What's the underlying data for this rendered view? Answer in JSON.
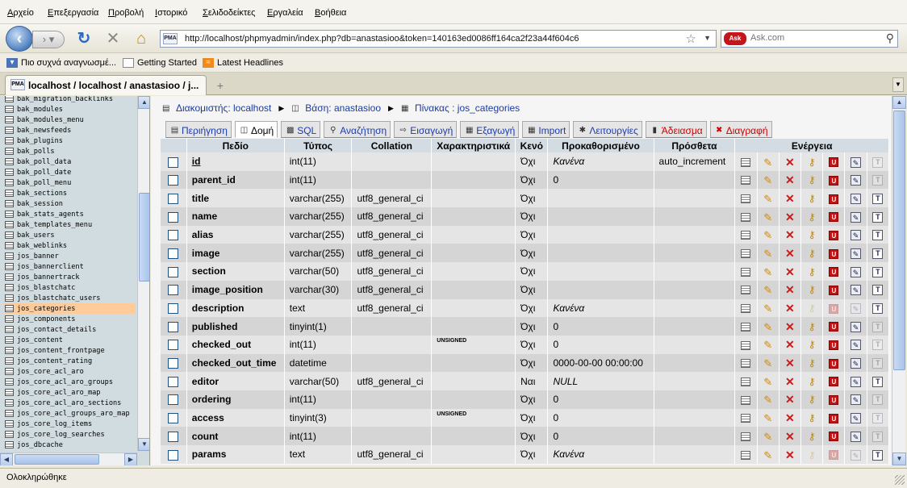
{
  "browser": {
    "menus": [
      "Αρχείο",
      "Επεξεργασία",
      "Προβολή",
      "Ιστορικό",
      "Σελιδοδείκτες",
      "Εργαλεία",
      "Βοήθεια"
    ],
    "url": "http://localhost/phpmyadmin/index.php?db=anastasioo&token=140163ed0086ff164ca2f23a44f604c6",
    "url_badge": "PMA",
    "search_engine": "Ask",
    "search_placeholder": "Ask.com",
    "bookmarks": [
      "Πιο συχνά αναγνωσμέ...",
      "Getting Started",
      "Latest Headlines"
    ],
    "tab_title": "localhost / localhost / anastasioo / j...",
    "status": "Ολοκληρώθηκε"
  },
  "sidebar": {
    "tables": [
      "bak_migration_backlinks",
      "bak_modules",
      "bak_modules_menu",
      "bak_newsfeeds",
      "bak_plugins",
      "bak_polls",
      "bak_poll_data",
      "bak_poll_date",
      "bak_poll_menu",
      "bak_sections",
      "bak_session",
      "bak_stats_agents",
      "bak_templates_menu",
      "bak_users",
      "bak_weblinks",
      "jos_banner",
      "jos_bannerclient",
      "jos_bannertrack",
      "jos_blastchatc",
      "jos_blastchatc_users",
      "jos_categories",
      "jos_components",
      "jos_contact_details",
      "jos_content",
      "jos_content_frontpage",
      "jos_content_rating",
      "jos_core_acl_aro",
      "jos_core_acl_aro_groups",
      "jos_core_acl_aro_map",
      "jos_core_acl_aro_sections",
      "jos_core_acl_groups_aro_map",
      "jos_core_log_items",
      "jos_core_log_searches",
      "jos_dbcache"
    ],
    "current": "jos_categories"
  },
  "breadcrumb": {
    "server": "Διακομιστής: localhost",
    "database": "Βάση: anastasioo",
    "table": "Πίνακας : jos_categories"
  },
  "tabs": [
    {
      "label": "Περιήγηση",
      "icon": "browse-icon"
    },
    {
      "label": "Δομή",
      "icon": "structure-icon",
      "active": true
    },
    {
      "label": "SQL",
      "icon": "sql-icon"
    },
    {
      "label": "Αναζήτηση",
      "icon": "search-icon"
    },
    {
      "label": "Εισαγωγή",
      "icon": "insert-icon"
    },
    {
      "label": "Εξαγωγή",
      "icon": "export-icon"
    },
    {
      "label": "Import",
      "icon": "import-icon"
    },
    {
      "label": "Λειτουργίες",
      "icon": "operations-icon"
    },
    {
      "label": "Άδειασμα",
      "icon": "empty-icon",
      "danger": true
    },
    {
      "label": "Διαγραφή",
      "icon": "drop-icon",
      "danger": true
    }
  ],
  "columns": [
    "Πεδίο",
    "Τύπος",
    "Collation",
    "Χαρακτηριστικά",
    "Κενό",
    "Προκαθορισμένο",
    "Πρόσθετα",
    "Ενέργεια"
  ],
  "rows": [
    {
      "name": "id",
      "type": "int(11)",
      "collation": "",
      "attributes": "",
      "null": "Όχι",
      "default": "Κανένα",
      "extra": "auto_increment",
      "primary": true
    },
    {
      "name": "parent_id",
      "type": "int(11)",
      "collation": "",
      "attributes": "",
      "null": "Όχι",
      "default": "0",
      "extra": ""
    },
    {
      "name": "title",
      "type": "varchar(255)",
      "collation": "utf8_general_ci",
      "attributes": "",
      "null": "Όχι",
      "default": "",
      "extra": ""
    },
    {
      "name": "name",
      "type": "varchar(255)",
      "collation": "utf8_general_ci",
      "attributes": "",
      "null": "Όχι",
      "default": "",
      "extra": ""
    },
    {
      "name": "alias",
      "type": "varchar(255)",
      "collation": "utf8_general_ci",
      "attributes": "",
      "null": "Όχι",
      "default": "",
      "extra": ""
    },
    {
      "name": "image",
      "type": "varchar(255)",
      "collation": "utf8_general_ci",
      "attributes": "",
      "null": "Όχι",
      "default": "",
      "extra": ""
    },
    {
      "name": "section",
      "type": "varchar(50)",
      "collation": "utf8_general_ci",
      "attributes": "",
      "null": "Όχι",
      "default": "",
      "extra": ""
    },
    {
      "name": "image_position",
      "type": "varchar(30)",
      "collation": "utf8_general_ci",
      "attributes": "",
      "null": "Όχι",
      "default": "",
      "extra": ""
    },
    {
      "name": "description",
      "type": "text",
      "collation": "utf8_general_ci",
      "attributes": "",
      "null": "Όχι",
      "default": "Κανένα",
      "extra": "",
      "text_type": true
    },
    {
      "name": "published",
      "type": "tinyint(1)",
      "collation": "",
      "attributes": "",
      "null": "Όχι",
      "default": "0",
      "extra": ""
    },
    {
      "name": "checked_out",
      "type": "int(11)",
      "collation": "",
      "attributes": "UNSIGNED",
      "null": "Όχι",
      "default": "0",
      "extra": ""
    },
    {
      "name": "checked_out_time",
      "type": "datetime",
      "collation": "",
      "attributes": "",
      "null": "Όχι",
      "default": "0000-00-00 00:00:00",
      "extra": ""
    },
    {
      "name": "editor",
      "type": "varchar(50)",
      "collation": "utf8_general_ci",
      "attributes": "",
      "null": "Ναι",
      "default": "NULL",
      "extra": ""
    },
    {
      "name": "ordering",
      "type": "int(11)",
      "collation": "",
      "attributes": "",
      "null": "Όχι",
      "default": "0",
      "extra": ""
    },
    {
      "name": "access",
      "type": "tinyint(3)",
      "collation": "",
      "attributes": "UNSIGNED",
      "null": "Όχι",
      "default": "0",
      "extra": ""
    },
    {
      "name": "count",
      "type": "int(11)",
      "collation": "",
      "attributes": "",
      "null": "Όχι",
      "default": "0",
      "extra": ""
    },
    {
      "name": "params",
      "type": "text",
      "collation": "utf8_general_ci",
      "attributes": "",
      "null": "Όχι",
      "default": "Κανένα",
      "extra": "",
      "text_type": true
    }
  ]
}
